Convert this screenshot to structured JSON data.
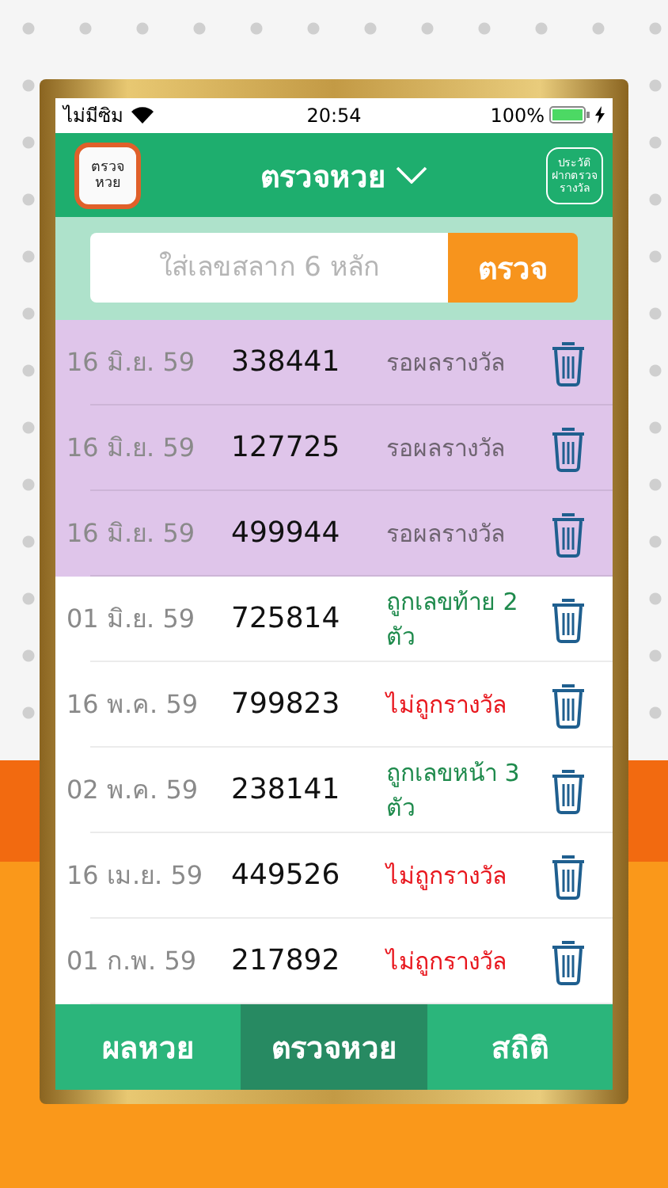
{
  "status_bar": {
    "carrier": "ไม่มีซิม",
    "time": "20:54",
    "battery": "100%"
  },
  "header": {
    "logo_text": [
      "ตรวจ",
      "หวย"
    ],
    "title": "ตรวจหวย",
    "history_button": [
      "ประวัติ",
      "ฝากตรวจ",
      "รางวัล"
    ]
  },
  "search": {
    "placeholder": "ใส่เลขสลาก 6 หลัก",
    "button": "ตรวจ"
  },
  "rows": [
    {
      "date": "16 มิ.ย. 59",
      "number": "338441",
      "result": "รอผลรางวัล",
      "kind": "pending"
    },
    {
      "date": "16 มิ.ย. 59",
      "number": "127725",
      "result": "รอผลรางวัล",
      "kind": "pending"
    },
    {
      "date": "16 มิ.ย. 59",
      "number": "499944",
      "result": "รอผลรางวัล",
      "kind": "pending"
    },
    {
      "date": "01 มิ.ย. 59",
      "number": "725814",
      "result": "ถูกเลขท้าย 2 ตัว",
      "kind": "win"
    },
    {
      "date": "16 พ.ค. 59",
      "number": "799823",
      "result": "ไม่ถูกรางวัล",
      "kind": "lose"
    },
    {
      "date": "02 พ.ค. 59",
      "number": "238141",
      "result": "ถูกเลขหน้า 3 ตัว",
      "kind": "win"
    },
    {
      "date": "16 เม.ย. 59",
      "number": "449526",
      "result": "ไม่ถูกรางวัล",
      "kind": "lose"
    },
    {
      "date": "01 ก.พ. 59",
      "number": "217892",
      "result": "ไม่ถูกรางวัล",
      "kind": "lose"
    }
  ],
  "tabs": [
    {
      "label": "ผลหวย",
      "selected": false
    },
    {
      "label": "ตรวจหวย",
      "selected": true
    },
    {
      "label": "สถิติ",
      "selected": false
    }
  ]
}
